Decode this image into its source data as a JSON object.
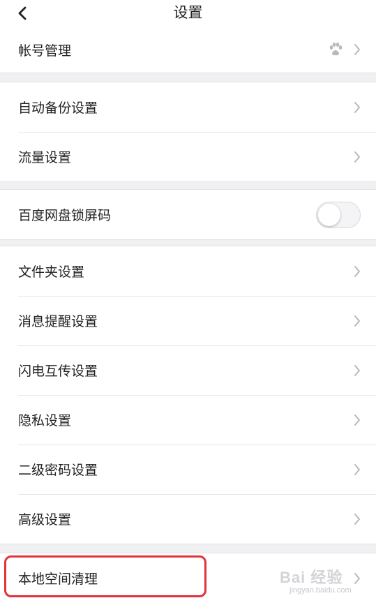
{
  "header": {
    "title": "设置"
  },
  "groups": {
    "account": {
      "label": "帐号管理"
    },
    "backup": [
      {
        "label": "自动备份设置"
      },
      {
        "label": "流量设置"
      }
    ],
    "lock": {
      "label": "百度网盘锁屏码",
      "toggle_on": false
    },
    "settings": [
      {
        "label": "文件夹设置"
      },
      {
        "label": "消息提醒设置"
      },
      {
        "label": "闪电互传设置"
      },
      {
        "label": "隐私设置"
      },
      {
        "label": "二级密码设置"
      },
      {
        "label": "高级设置"
      }
    ],
    "clean": {
      "label": "本地空间清理"
    }
  },
  "watermark": {
    "text": "Bai 经验",
    "url": "jingyan.baidu.com"
  },
  "colors": {
    "highlight": "#e3323a",
    "background": "#f0f0f3"
  }
}
